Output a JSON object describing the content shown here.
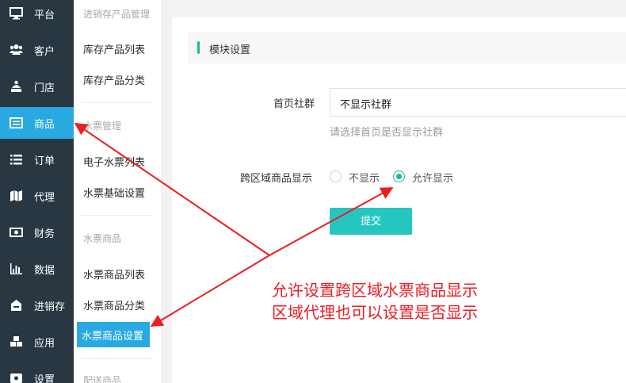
{
  "sidebar": {
    "items": [
      {
        "label": "平台",
        "icon": "monitor-icon"
      },
      {
        "label": "客户",
        "icon": "users-icon"
      },
      {
        "label": "门店",
        "icon": "store-icon"
      },
      {
        "label": "商品",
        "icon": "list-icon",
        "active": true
      },
      {
        "label": "订单",
        "icon": "order-list-icon"
      },
      {
        "label": "代理",
        "icon": "map-icon"
      },
      {
        "label": "财务",
        "icon": "money-icon"
      },
      {
        "label": "数据",
        "icon": "bar-chart-icon"
      },
      {
        "label": "进销存",
        "icon": "inbox-icon"
      },
      {
        "label": "应用",
        "icon": "cubes-icon"
      },
      {
        "label": "设置",
        "icon": "settings-icon"
      }
    ]
  },
  "submenu": {
    "groups": [
      {
        "title": "进销存产品管理",
        "items": [
          "库存产品列表",
          "库存产品分类"
        ]
      },
      {
        "title": "水票管理",
        "items": [
          "电子水票列表",
          "水票基础设置"
        ]
      },
      {
        "title": "水票商品",
        "items": [
          "水票商品列表",
          "水票商品分类",
          "水票商品设置"
        ]
      },
      {
        "title": "配送商品",
        "items": []
      }
    ],
    "active_item": "水票商品设置"
  },
  "main": {
    "section_title": "模块设置",
    "home_community": {
      "label": "首页社群",
      "selected": "不显示社群",
      "help": "请选择首页是否显示社群"
    },
    "cross_region": {
      "label": "跨区域商品显示",
      "options": [
        "不显示",
        "允许显示"
      ],
      "selected": "允许显示"
    },
    "submit_label": "提交"
  },
  "annotation": {
    "line1": "允许设置跨区域水票商品显示",
    "line2": "区域代理也可以设置是否显示",
    "color": "#ee1c24"
  },
  "colors": {
    "sidebar_bg": "#283742",
    "accent_blue": "#29a9e1",
    "accent_teal": "#1fb59b",
    "button": "#26c6c0"
  }
}
